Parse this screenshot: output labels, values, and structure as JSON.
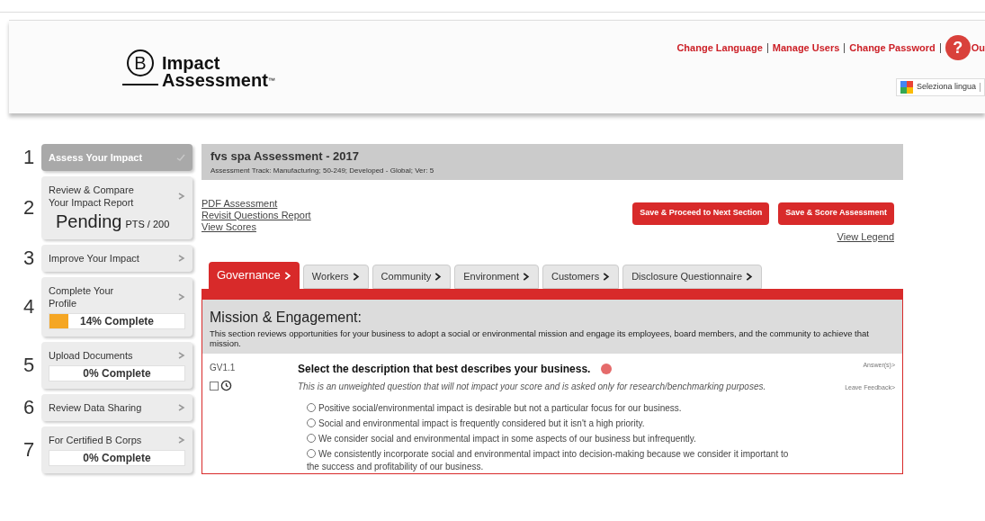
{
  "header": {
    "logo_mark": "B",
    "logo_line1": "Impact",
    "logo_line2": "Assessment",
    "logo_tm": "™",
    "links": [
      "Change Language",
      "Manage Users",
      "Change Password"
    ],
    "link_cut": "Ou",
    "help": "?",
    "language_select": "Seleziona lingua"
  },
  "sidebar": {
    "items": [
      {
        "number": "1",
        "label": "Assess Your Impact",
        "selected": true
      },
      {
        "number": "2",
        "label": "Review & Compare Your Impact Report",
        "selected": false,
        "score": "Pending",
        "score_unit": "PTS / 200"
      },
      {
        "number": "3",
        "label": "Improve Your Impact",
        "selected": false
      },
      {
        "number": "4",
        "label": "Complete Your Profile",
        "selected": false,
        "level": 0.14,
        "progress": "14% Complete"
      },
      {
        "number": "5",
        "label": "Upload Documents",
        "selected": false,
        "level": 0,
        "progress": "0% Complete"
      },
      {
        "number": "6",
        "label": "Review Data Sharing",
        "selected": false
      },
      {
        "number": "7",
        "label": "For Certified B Corps",
        "selected": false,
        "level": 0,
        "progress": "0% Complete"
      }
    ]
  },
  "assessment": {
    "title": "fvs spa Assessment - 2017",
    "track": "Assessment Track: Manufacturing; 50-249; Developed - Global; Ver: 5",
    "links": [
      "PDF Assessment",
      "Revisit Questions Report",
      "View Scores"
    ],
    "buttons": [
      "Save & Proceed to Next Section",
      "Save & Score Assessment"
    ],
    "legend_link": "View Legend",
    "tabs": [
      {
        "label": "Governance",
        "selected": true
      },
      {
        "label": "Workers",
        "selected": false
      },
      {
        "label": "Community",
        "selected": false
      },
      {
        "label": "Environment",
        "selected": false
      },
      {
        "label": "Customers",
        "selected": false
      },
      {
        "label": "Disclosure Questionnaire",
        "selected": false
      }
    ],
    "section": {
      "title": "Mission & Engagement:",
      "description": "This section reviews opportunities for your business to adopt a social or environmental mission and engage its employees, board members, and the community to achieve that mission."
    },
    "question": {
      "code": "GV1.1",
      "flagged": false,
      "text": "Select the description that best describes your business.",
      "note": "This is an unweighted question that will not impact your score and is asked only for research/benchmarking purposes.",
      "answers_link": "Answer(s)>",
      "feedback_link": "Leave Feedback>",
      "options": [
        {
          "label": "Positive social/environmental impact is desirable but not a particular focus for our business.",
          "selected": false
        },
        {
          "label": "Social and environmental impact is frequently considered but it isn't a high priority.",
          "selected": false
        },
        {
          "label": "We consider social and environmental impact in some aspects of our business but infrequently.",
          "selected": false
        },
        {
          "label": "We consistently incorporate social and environmental impact into decision-making because we consider it important to the success and profitability of our business.",
          "selected": false
        }
      ]
    }
  }
}
